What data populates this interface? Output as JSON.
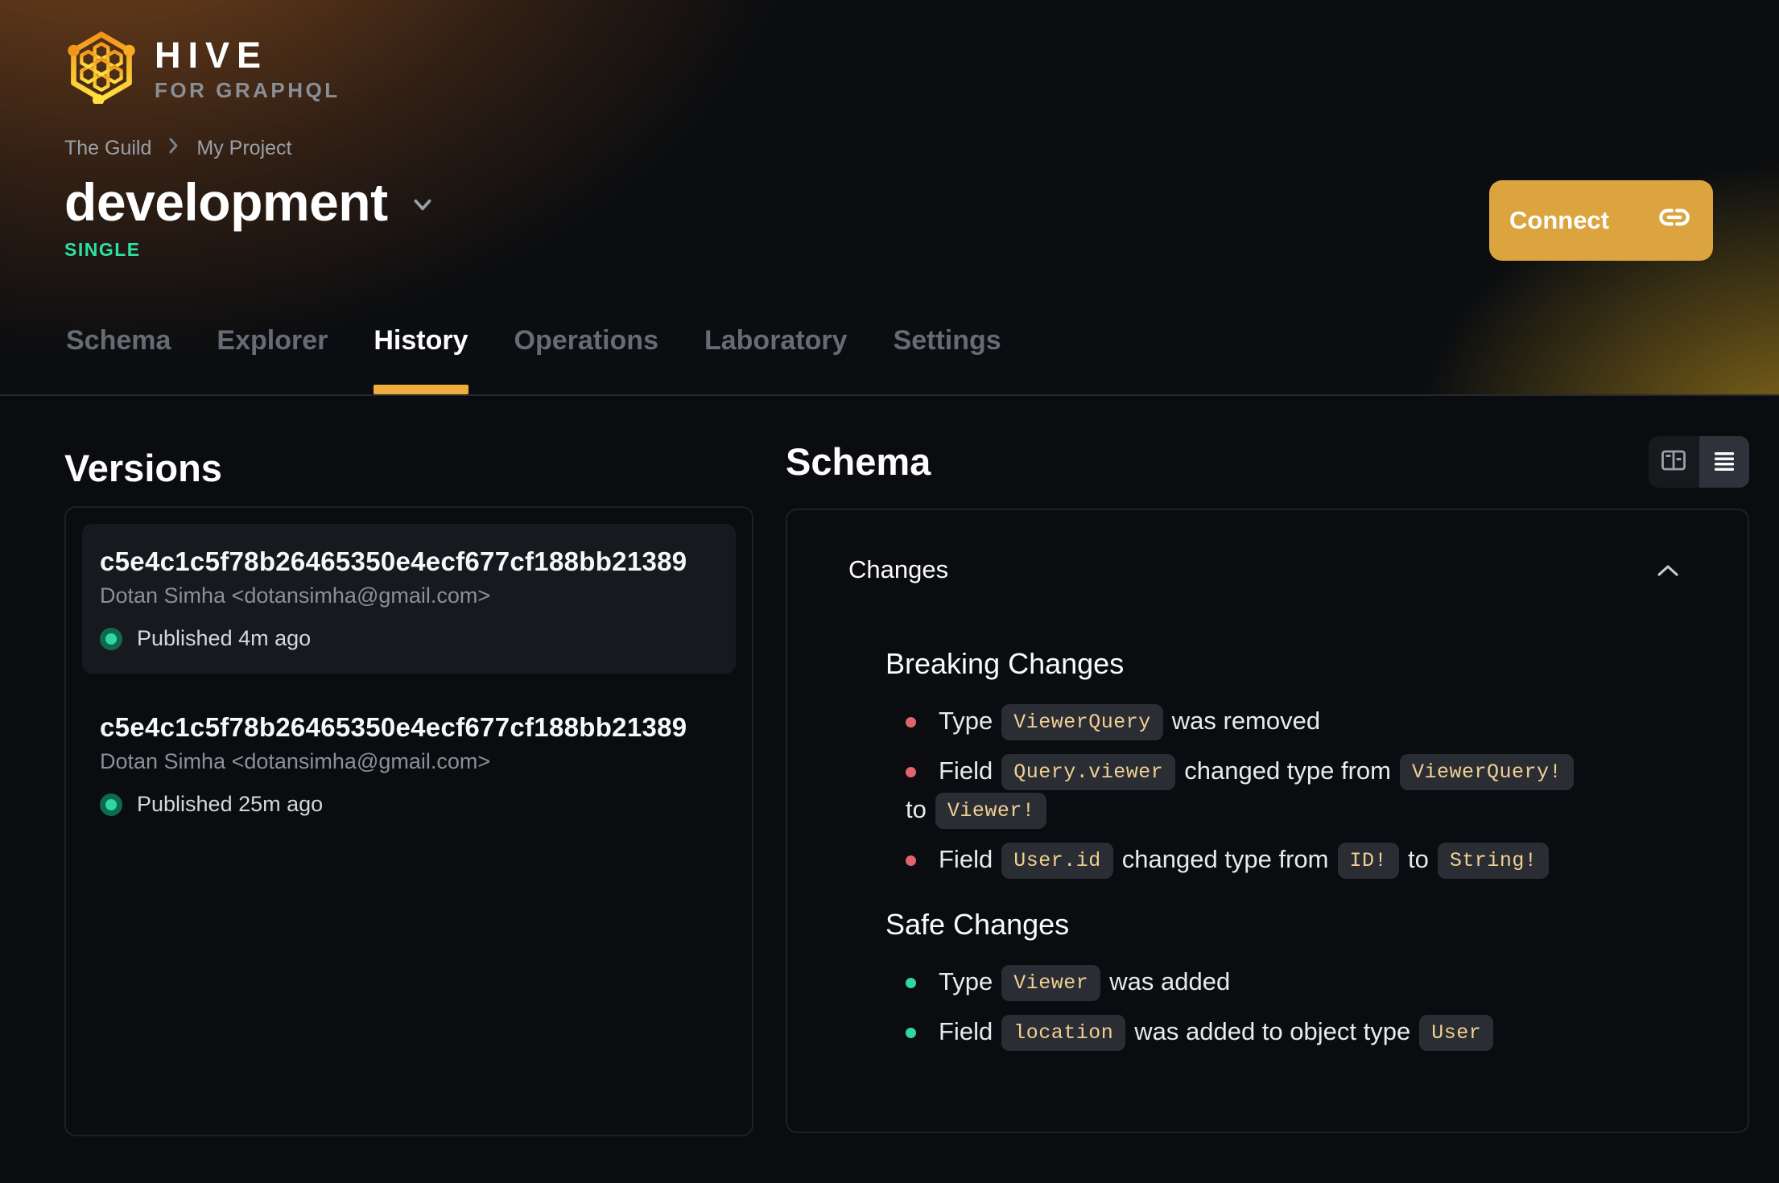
{
  "brand": {
    "name": "HIVE",
    "tagline": "FOR GRAPHQL"
  },
  "breadcrumb": {
    "items": [
      "The Guild",
      "My Project"
    ]
  },
  "target": {
    "name": "development",
    "badge": "SINGLE"
  },
  "header_actions": {
    "connect_label": "Connect"
  },
  "tabs": [
    {
      "label": "Schema",
      "active": false
    },
    {
      "label": "Explorer",
      "active": false
    },
    {
      "label": "History",
      "active": true
    },
    {
      "label": "Operations",
      "active": false
    },
    {
      "label": "Laboratory",
      "active": false
    },
    {
      "label": "Settings",
      "active": false
    }
  ],
  "versions": {
    "heading": "Versions",
    "items": [
      {
        "hash": "c5e4c1c5f78b26465350e4ecf677cf188bb21389",
        "author": "Dotan Simha <dotansimha@gmail.com>",
        "status": "Published 4m ago",
        "selected": true
      },
      {
        "hash": "c5e4c1c5f78b26465350e4ecf677cf188bb21389",
        "author": "Dotan Simha <dotansimha@gmail.com>",
        "status": "Published 25m ago",
        "selected": false
      }
    ]
  },
  "schema_panel": {
    "heading": "Schema",
    "view_toggle": {
      "options": [
        "split-view",
        "list-view"
      ],
      "active": "list-view"
    },
    "changes": {
      "title": "Changes",
      "sections": [
        {
          "title": "Breaking Changes",
          "severity": "breaking",
          "items": [
            {
              "parts": [
                "Type",
                "ViewerQuery",
                "was removed"
              ]
            },
            {
              "parts": [
                "Field",
                "Query.viewer",
                "changed type from",
                "ViewerQuery!",
                "to",
                "Viewer!"
              ]
            },
            {
              "parts": [
                "Field",
                "User.id",
                "changed type from",
                "ID!",
                "to",
                "String!"
              ]
            }
          ]
        },
        {
          "title": "Safe Changes",
          "severity": "safe",
          "items": [
            {
              "parts": [
                "Type",
                "Viewer",
                "was added"
              ]
            },
            {
              "parts": [
                "Field",
                "location",
                "was added to object type",
                "User"
              ]
            }
          ]
        }
      ]
    }
  },
  "colors": {
    "accent_amber": "#e8a93d",
    "badge_green": "#2ee0a1",
    "breaking_red": "#e0646e",
    "safe_green": "#2fd79f",
    "chip_text": "#f1d092"
  }
}
